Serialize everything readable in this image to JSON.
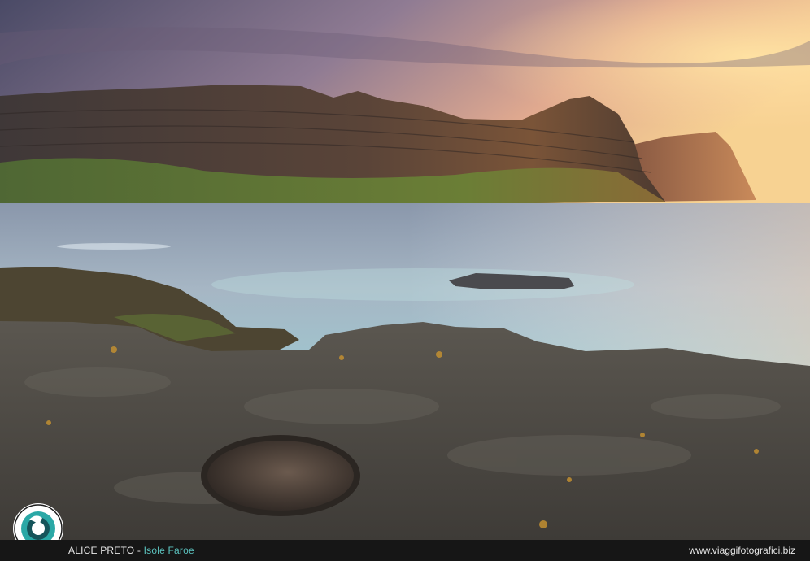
{
  "photo": {
    "description_icon": "landscape-photo",
    "palette": {
      "sky_top": "#4b4a66",
      "sky_mid": "#a8869b",
      "sky_glow": "#f4c98a",
      "cliff": "#4a3a34",
      "grass": "#5f7a3a",
      "sea": "#8aa2b6",
      "rock": "#4d4a45"
    }
  },
  "logo": {
    "icon": "photographer-badge-icon",
    "text": "VIAGGIFOTOGRAFICI.BIZ",
    "ring_color": "#2aa8a6"
  },
  "footer": {
    "author": "ALICE PRETO",
    "separator": " - ",
    "location": "Isole Faroe",
    "website": "www.viaggifotografici.biz"
  }
}
